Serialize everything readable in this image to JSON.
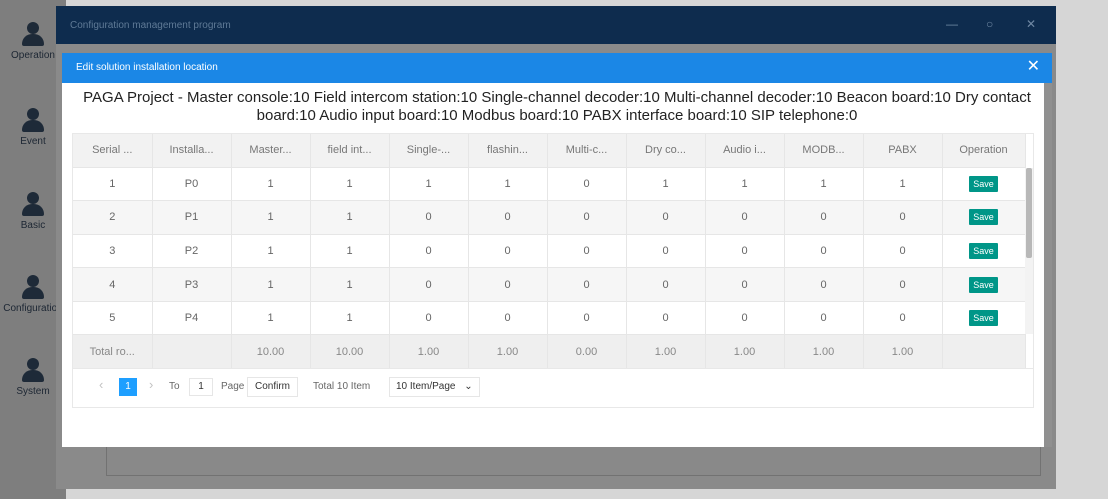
{
  "app": {
    "title": "Configuration management program",
    "window_buttons": [
      "—",
      "○",
      "✕"
    ]
  },
  "sidebar": {
    "items": [
      {
        "label": "Operation"
      },
      {
        "label": "Event"
      },
      {
        "label": "Basic"
      },
      {
        "label": "Configuration"
      },
      {
        "label": "System"
      }
    ]
  },
  "modal": {
    "title": "Edit solution installation location",
    "close_label": "✕",
    "summary": "PAGA Project - Master console:10  Field intercom station:10  Single-channel decoder:10  Multi-channel decoder:10  Beacon board:10  Dry contact board:10  Audio input board:10  Modbus board:10  PABX interface board:10  SIP telephone:0"
  },
  "table": {
    "headers": [
      "Serial ...",
      "Installa...",
      "Master...",
      "field int...",
      "Single-...",
      "flashin...",
      "Multi-c...",
      "Dry co...",
      "Audio i...",
      "MODB...",
      "PABX",
      "Operation"
    ],
    "rows": [
      [
        "1",
        "P0",
        "1",
        "1",
        "1",
        "1",
        "0",
        "1",
        "1",
        "1",
        "1"
      ],
      [
        "2",
        "P1",
        "1",
        "1",
        "0",
        "0",
        "0",
        "0",
        "0",
        "0",
        "0"
      ],
      [
        "3",
        "P2",
        "1",
        "1",
        "0",
        "0",
        "0",
        "0",
        "0",
        "0",
        "0"
      ],
      [
        "4",
        "P3",
        "1",
        "1",
        "0",
        "0",
        "0",
        "0",
        "0",
        "0",
        "0"
      ],
      [
        "5",
        "P4",
        "1",
        "1",
        "0",
        "0",
        "0",
        "0",
        "0",
        "0",
        "0"
      ]
    ],
    "save_label": "Save",
    "total_row": [
      "Total ro...",
      "",
      "10.00",
      "10.00",
      "1.00",
      "1.00",
      "0.00",
      "1.00",
      "1.00",
      "1.00",
      "1.00",
      ""
    ]
  },
  "pagination": {
    "prev": "‹",
    "current_page": "1",
    "next": "›",
    "to_label": "To",
    "goto_value": "1",
    "page_label": "Page",
    "confirm_label": "Confirm",
    "total_label": "Total 10 Item",
    "page_size": "10 Item/Page"
  },
  "colors": {
    "accent": "#1b87e6",
    "save_button": "#009688",
    "current_page": "#1e9fff"
  }
}
